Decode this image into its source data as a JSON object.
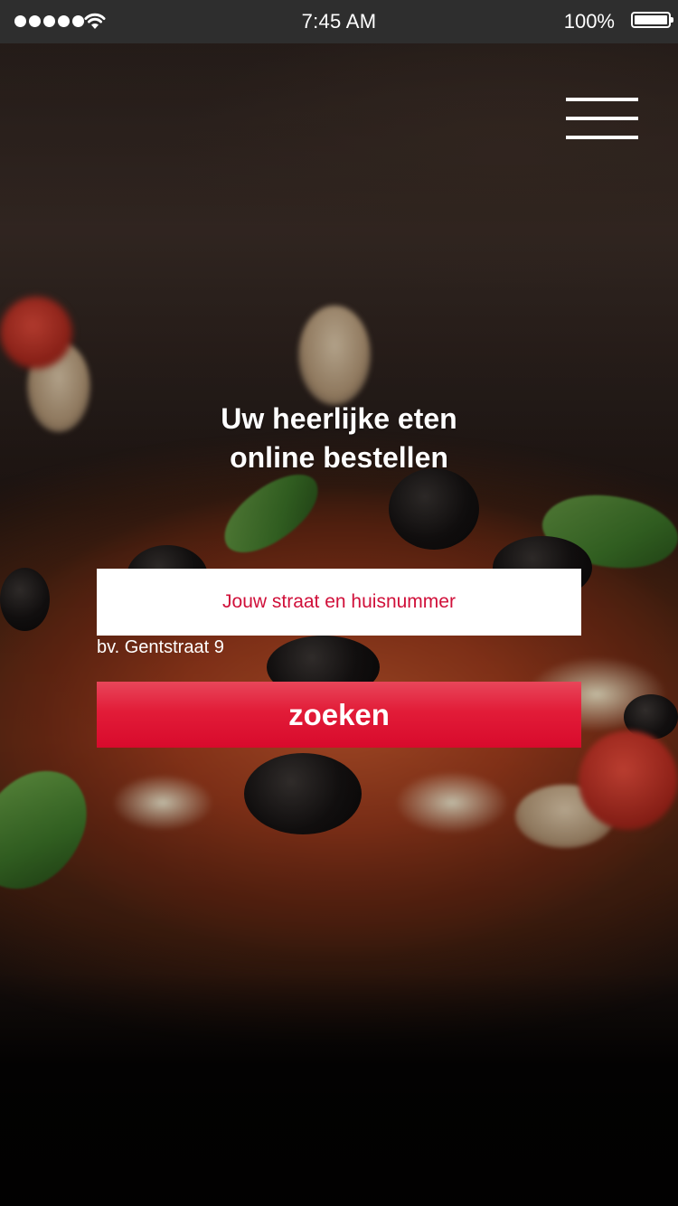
{
  "status_bar": {
    "time": "7:45 AM",
    "battery_percent": "100%",
    "battery_level": 1.0,
    "signal_bars": 5,
    "icons": [
      "signal-dots-icon",
      "wifi-icon",
      "battery-icon"
    ]
  },
  "header": {
    "menu_icon": "hamburger-menu-icon"
  },
  "hero": {
    "headline_line1": "Uw heerlijke eten",
    "headline_line2": "online bestellen"
  },
  "search": {
    "placeholder": "Jouw straat en huisnummer",
    "value": "",
    "hint": "bv. Gentstraat 9",
    "button_label": "zoeken"
  },
  "colors": {
    "accent": "#e21c38",
    "placeholder_text": "#d0103a",
    "status_bar_bg": "#2e2e2e"
  }
}
